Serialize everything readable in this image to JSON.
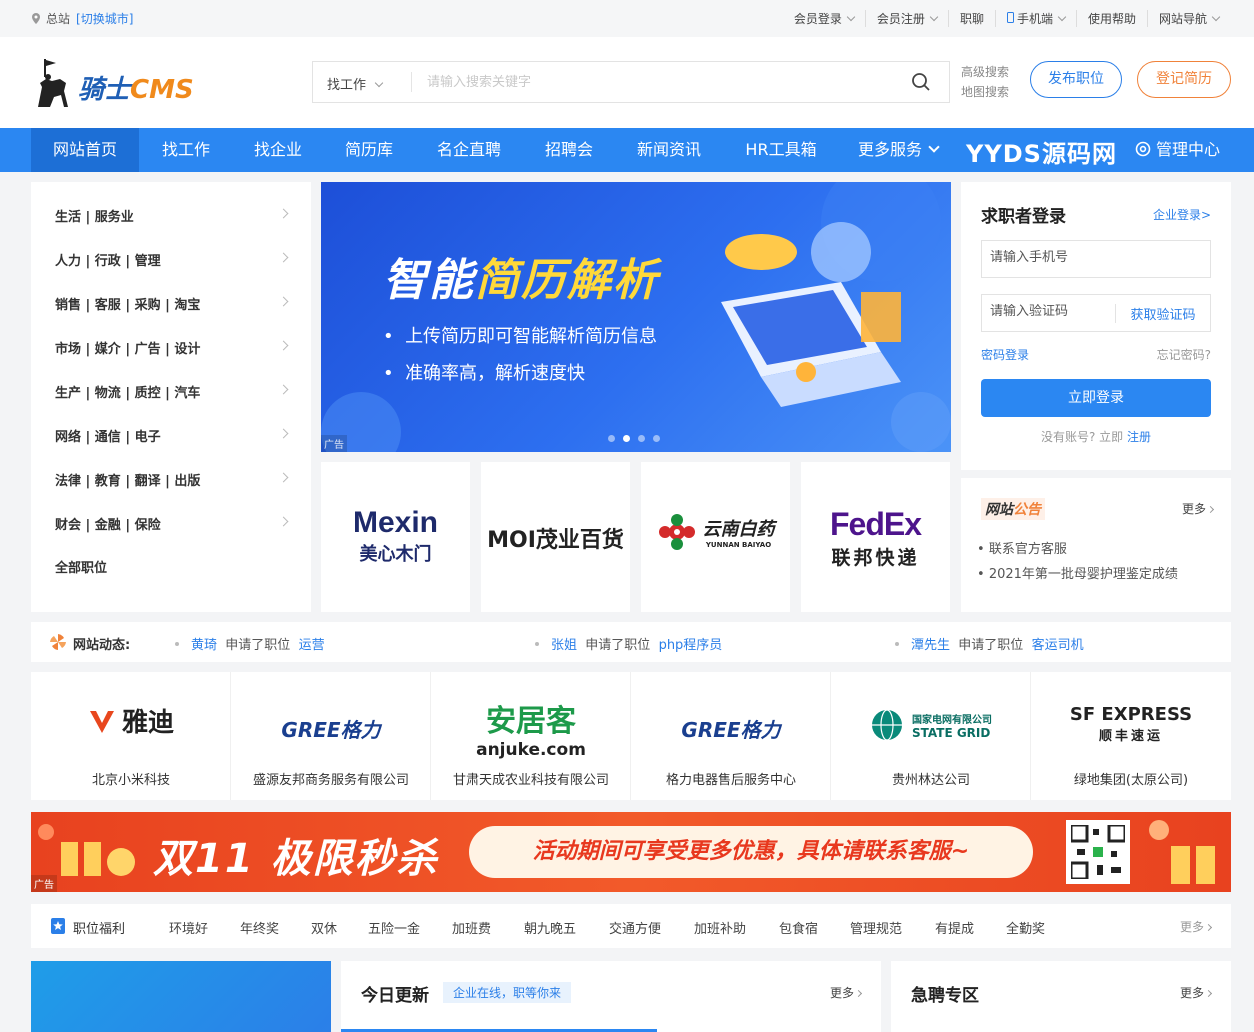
{
  "topbar": {
    "location": "总站",
    "switch_city": "[切换城市]",
    "links": [
      "会员登录",
      "会员注册",
      "职聊",
      "手机端",
      "使用帮助",
      "网站导航"
    ]
  },
  "header": {
    "brand_prefix": "骑士",
    "brand_suffix": "CMS",
    "search_type": "找工作",
    "search_placeholder": "请输入搜索关键字",
    "advanced_search": "高级搜索",
    "map_search": "地图搜索",
    "post_job": "发布职位",
    "register_resume": "登记简历"
  },
  "nav": {
    "items": [
      "网站首页",
      "找工作",
      "找企业",
      "简历库",
      "名企直聘",
      "招聘会",
      "新闻资讯",
      "HR工具箱",
      "更多服务"
    ],
    "watermark": "YYDS源码网",
    "admin": "管理中心"
  },
  "categories": [
    "生活 | 服务业",
    "人力 | 行政 | 管理",
    "销售 | 客服 | 采购 | 淘宝",
    "市场 | 媒介 | 广告 | 设计",
    "生产 | 物流 | 质控 | 汽车",
    "网络 | 通信 | 电子",
    "法律 | 教育 | 翻译 | 出版",
    "财会 | 金融 | 保险",
    "全部职位"
  ],
  "banner": {
    "title_a": "智能",
    "title_b": "简历解析",
    "bullet1": "上传简历即可智能解析简历信息",
    "bullet2": "准确率高，解析速度快",
    "ad": "广告"
  },
  "brands": [
    {
      "line1": "Mexin",
      "line2": "美心木门"
    },
    {
      "line1": "MOI茂业百货",
      "line2": ""
    },
    {
      "line1": "云南白药",
      "line2": "YUNNAN BAIYAO"
    },
    {
      "line1": "FedEx",
      "line2": "联邦快递"
    }
  ],
  "login": {
    "title": "求职者登录",
    "enterprise_login": "企业登录>",
    "phone_placeholder": "请输入手机号",
    "code_placeholder": "请输入验证码",
    "get_code": "获取验证码",
    "password_login": "密码登录",
    "forgot": "忘记密码?",
    "submit": "立即登录",
    "no_account": "没有账号? 立即",
    "register": "注册"
  },
  "notice": {
    "title_a": "网站",
    "title_b": "公告",
    "more": "更多",
    "items": [
      "联系官方客服",
      "2021年第一批母婴护理鉴定成绩"
    ]
  },
  "dynamics": {
    "label": "网站动态:",
    "items": [
      {
        "name": "黄琦",
        "action": "申请了职位",
        "job": "运营"
      },
      {
        "name": "张姐",
        "action": "申请了职位",
        "job": "php程序员"
      },
      {
        "name": "潭先生",
        "action": "申请了职位",
        "job": "客运司机"
      }
    ]
  },
  "companies": [
    {
      "logo": "雅迪",
      "name": "北京小米科技"
    },
    {
      "logo": "GREE格力",
      "name": "盛源友邦商务服务有限公司"
    },
    {
      "logo": "安居客",
      "logo2": "anjuke.com",
      "name": "甘肃天成农业科技有限公司"
    },
    {
      "logo": "GREE格力",
      "name": "格力电器售后服务中心"
    },
    {
      "logo": "国家电网有限公司",
      "logo2": "STATE GRID",
      "name": "贵州林达公司"
    },
    {
      "logo": "SF EXPRESS",
      "logo2": "顺丰速运",
      "name": "绿地集团(太原公司)"
    }
  ],
  "promo": {
    "headline": "双11 极限秒杀",
    "message": "活动期间可享受更多优惠，具体请联系客服~",
    "ad": "广告"
  },
  "welfare": {
    "label": "职位福利",
    "tags": [
      "环境好",
      "年终奖",
      "双休",
      "五险一金",
      "加班费",
      "朝九晚五",
      "交通方便",
      "加班补助",
      "包食宿",
      "管理规范",
      "有提成",
      "全勤奖"
    ],
    "more": "更多"
  },
  "today": {
    "title": "今日更新",
    "tag": "企业在线，职等你来",
    "more": "更多"
  },
  "urgent": {
    "title": "急聘专区",
    "more": "更多"
  },
  "colors": {
    "primary": "#2b87f2",
    "accent": "#f0823a",
    "promo": "#e8421f"
  }
}
